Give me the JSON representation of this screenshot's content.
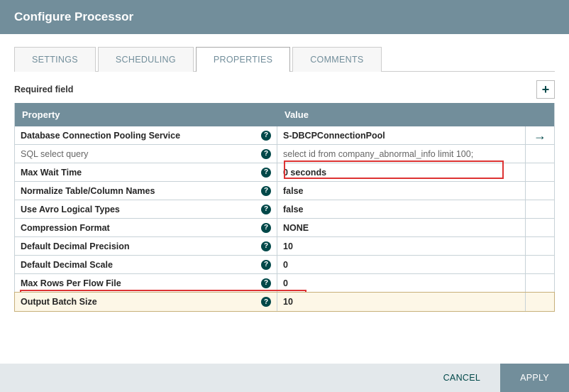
{
  "title": "Configure Processor",
  "tabs": [
    {
      "label": "SETTINGS"
    },
    {
      "label": "SCHEDULING"
    },
    {
      "label": "PROPERTIES"
    },
    {
      "label": "COMMENTS"
    }
  ],
  "activeTabIndex": 2,
  "requiredFieldLabel": "Required field",
  "columns": {
    "property": "Property",
    "value": "Value"
  },
  "properties": [
    {
      "name": "Database Connection Pooling Service",
      "value": "S-DBCPConnectionPool",
      "bold": true,
      "action": "goto"
    },
    {
      "name": "SQL select query",
      "value": "select id from company_abnormal_info limit 100;",
      "bold": false
    },
    {
      "name": "Max Wait Time",
      "value": "0 seconds",
      "bold": true
    },
    {
      "name": "Normalize Table/Column Names",
      "value": "false",
      "bold": true
    },
    {
      "name": "Use Avro Logical Types",
      "value": "false",
      "bold": true
    },
    {
      "name": "Compression Format",
      "value": "NONE",
      "bold": true
    },
    {
      "name": "Default Decimal Precision",
      "value": "10",
      "bold": true
    },
    {
      "name": "Default Decimal Scale",
      "value": "0",
      "bold": true
    },
    {
      "name": "Max Rows Per Flow File",
      "value": "0",
      "bold": true
    },
    {
      "name": "Output Batch Size",
      "value": "10",
      "bold": true,
      "selected": true
    }
  ],
  "buttons": {
    "cancel": "CANCEL",
    "apply": "APPLY"
  },
  "icons": {
    "add": "+",
    "goto": "→",
    "help": "?"
  }
}
